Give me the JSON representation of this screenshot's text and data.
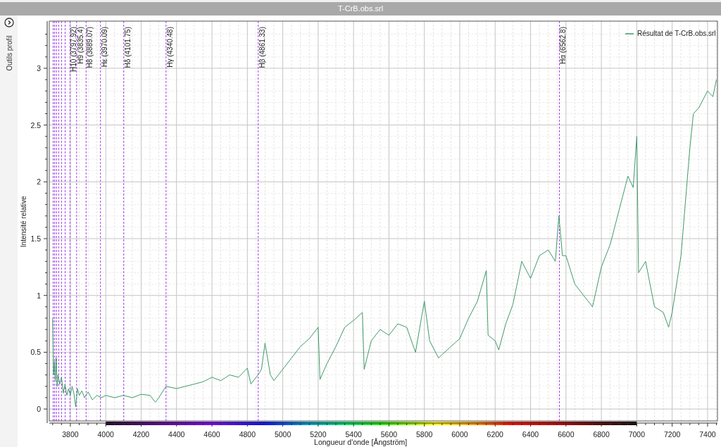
{
  "window": {
    "title": "T-CrB.obs.srl"
  },
  "side_panel": {
    "label": "Outils profil"
  },
  "chart": {
    "chart_data": {
      "type": "line",
      "xlabel": "Longueur d'onde [Ångström]",
      "ylabel": "Intensité relative",
      "xlim": [
        3681,
        7456
      ],
      "ylim": [
        -0.105,
        3.415
      ],
      "xticks": [
        3800,
        4000,
        4200,
        4400,
        4600,
        4800,
        5000,
        5200,
        5400,
        5600,
        5800,
        6000,
        6200,
        6400,
        6600,
        6800,
        7000,
        7200,
        7400
      ],
      "yticks": [
        {
          "value": 0,
          "label": "0"
        },
        {
          "value": 0.5,
          "label": "0.5"
        },
        {
          "value": 1,
          "label": "1"
        },
        {
          "value": 1.5,
          "label": "1.5"
        },
        {
          "value": 2,
          "label": "2"
        },
        {
          "value": 2.5,
          "label": "2.5"
        },
        {
          "value": 3,
          "label": "3"
        }
      ],
      "x": [
        3700,
        3705,
        3710,
        3715,
        3720,
        3725,
        3730,
        3740,
        3750,
        3760,
        3770,
        3780,
        3790,
        3800,
        3810,
        3820,
        3830,
        3840,
        3850,
        3865,
        3880,
        3900,
        3925,
        3950,
        3975,
        4000,
        4050,
        4100,
        4150,
        4200,
        4250,
        4280,
        4300,
        4340,
        4400,
        4450,
        4500,
        4550,
        4600,
        4650,
        4700,
        4750,
        4800,
        4820,
        4860,
        4880,
        4900,
        4930,
        4950,
        5000,
        5050,
        5100,
        5150,
        5200,
        5210,
        5250,
        5300,
        5350,
        5400,
        5450,
        5460,
        5500,
        5550,
        5600,
        5650,
        5700,
        5750,
        5800,
        5830,
        5880,
        5950,
        6000,
        6050,
        6100,
        6150,
        6160,
        6200,
        6220,
        6260,
        6300,
        6350,
        6400,
        6450,
        6500,
        6540,
        6560,
        6580,
        6600,
        6650,
        6700,
        6750,
        6800,
        6850,
        6900,
        6950,
        6980,
        7000,
        7010,
        7050,
        7100,
        7150,
        7180,
        7200,
        7250,
        7300,
        7320,
        7350,
        7400,
        7430,
        7450
      ],
      "series": [
        {
          "name": "Résultat de T-CrB.obs.srl",
          "color": "#3f9a6a",
          "values": [
            0.8,
            0.3,
            0.42,
            0.25,
            0.45,
            0.2,
            0.3,
            0.22,
            0.28,
            0.14,
            0.22,
            0.12,
            0.18,
            0.12,
            0.2,
            0.14,
            0.02,
            0.18,
            0.12,
            0.16,
            0.1,
            0.15,
            0.08,
            0.12,
            0.1,
            0.12,
            0.1,
            0.12,
            0.1,
            0.13,
            0.12,
            0.06,
            0.1,
            0.2,
            0.18,
            0.2,
            0.22,
            0.24,
            0.28,
            0.25,
            0.3,
            0.28,
            0.36,
            0.22,
            0.3,
            0.35,
            0.58,
            0.3,
            0.25,
            0.35,
            0.45,
            0.55,
            0.62,
            0.72,
            0.26,
            0.4,
            0.55,
            0.72,
            0.78,
            0.85,
            0.35,
            0.6,
            0.7,
            0.65,
            0.75,
            0.72,
            0.5,
            0.95,
            0.6,
            0.45,
            0.55,
            0.62,
            0.8,
            0.95,
            1.22,
            0.65,
            0.6,
            0.52,
            0.75,
            0.92,
            1.3,
            1.15,
            1.35,
            1.4,
            1.3,
            1.7,
            1.35,
            1.35,
            1.1,
            1.0,
            0.9,
            1.25,
            1.45,
            1.75,
            2.05,
            1.95,
            2.4,
            1.2,
            1.3,
            0.9,
            0.85,
            0.72,
            0.85,
            1.35,
            2.3,
            2.6,
            2.65,
            2.8,
            2.75,
            2.9
          ]
        }
      ],
      "grid": true,
      "ref_lines": [
        {
          "axis": "x",
          "value": 3703.85
        },
        {
          "axis": "x",
          "value": 3711.97
        },
        {
          "axis": "x",
          "value": 3721.94
        },
        {
          "axis": "x",
          "value": 3734.37
        },
        {
          "axis": "x",
          "value": 3750.15
        },
        {
          "axis": "x",
          "value": 3770.63
        },
        {
          "axis": "x",
          "value": 3797.92,
          "label": "H10 (3797.92)"
        },
        {
          "axis": "x",
          "value": 3835.4,
          "label": "H9 (3835.4)"
        },
        {
          "axis": "x",
          "value": 3889.07,
          "label": "H8 (3889.07)"
        },
        {
          "axis": "x",
          "value": 3970.09,
          "label": "Hε (3970.09)"
        },
        {
          "axis": "x",
          "value": 4101.75,
          "label": "Hδ (4101.75)"
        },
        {
          "axis": "x",
          "value": 4340.48,
          "label": "Hγ (4340.48)"
        },
        {
          "axis": "x",
          "value": 4861.33,
          "label": "Hβ (4861.33)"
        },
        {
          "axis": "x",
          "value": 6562.8,
          "label": "Hα (6562.8)"
        }
      ]
    }
  }
}
